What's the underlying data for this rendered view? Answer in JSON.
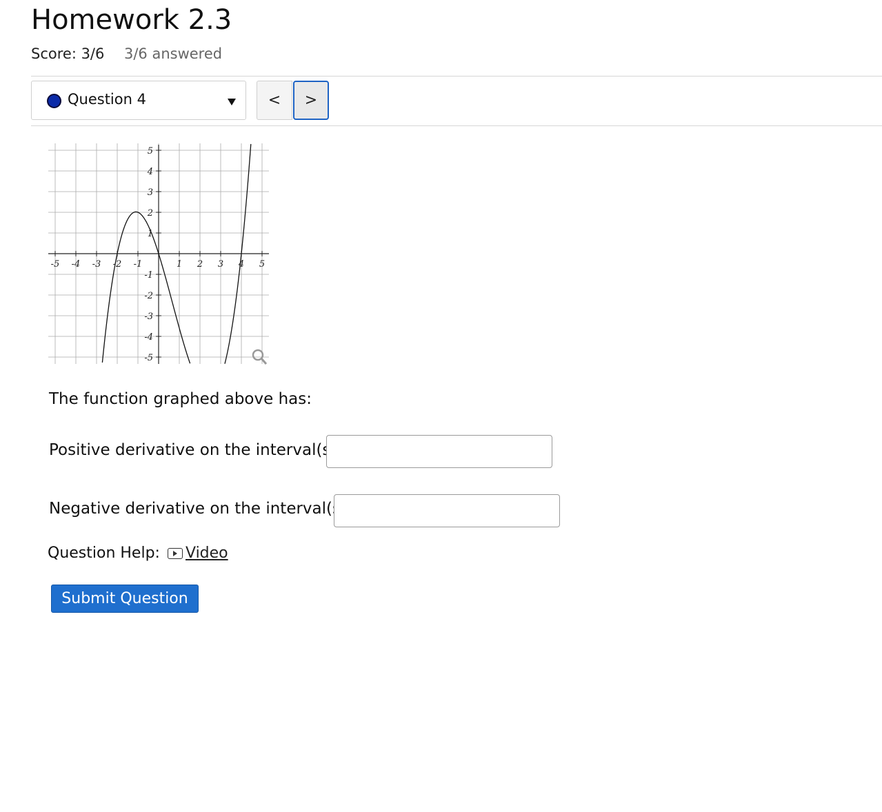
{
  "header": {
    "title": "Homework 2.3",
    "score": "Score: 3/6",
    "answered": "3/6 answered"
  },
  "question_nav": {
    "selected": "Question 4",
    "status_color": "#0b2aa8",
    "prev_label": "<",
    "next_label": ">"
  },
  "graph": {
    "x_ticks": [
      "-5",
      "-4",
      "-3",
      "-2",
      "-1",
      "1",
      "2",
      "3",
      "4",
      "5"
    ],
    "y_ticks": [
      "5",
      "4",
      "3",
      "2",
      "1",
      "-1",
      "-2",
      "-3",
      "-4",
      "-5"
    ],
    "zoom_icon": "magnifier-icon"
  },
  "question": {
    "prompt": "The function graphed above has:",
    "positive_label": "Positive derivative on the interval(s)",
    "positive_value": "",
    "negative_label": "Negative derivative on the interval(s)",
    "negative_value": ""
  },
  "help": {
    "label": "Question Help:",
    "video_label": "Video",
    "video_icon": "play-icon"
  },
  "submit_label": "Submit Question",
  "colors": {
    "accent": "#1f6fce",
    "focus_border": "#1e63c4"
  }
}
